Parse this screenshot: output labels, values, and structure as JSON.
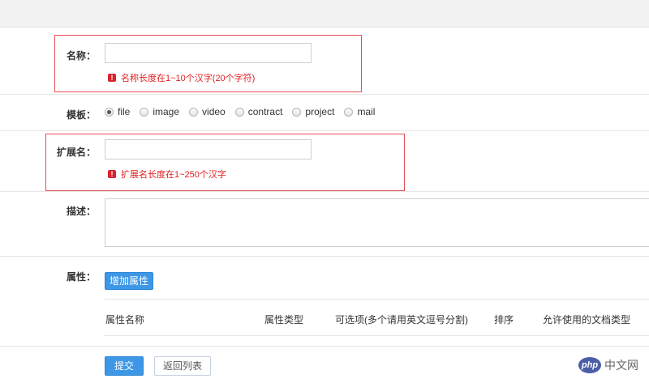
{
  "form": {
    "name": {
      "label": "名称：",
      "value": "",
      "error": "名称长度在1~10个汉字(20个字符)"
    },
    "template": {
      "label": "模板：",
      "selected": "file",
      "options": [
        {
          "label": "file",
          "checked": true
        },
        {
          "label": "image",
          "checked": false
        },
        {
          "label": "video",
          "checked": false
        },
        {
          "label": "contract",
          "checked": false
        },
        {
          "label": "project",
          "checked": false
        },
        {
          "label": "mail",
          "checked": false
        }
      ]
    },
    "extension": {
      "label": "扩展名：",
      "value": "",
      "error": "扩展名长度在1~250个汉字"
    },
    "description": {
      "label": "描述：",
      "value": ""
    },
    "attributes": {
      "label": "属性：",
      "add_button": "增加属性",
      "columns": [
        "属性名称",
        "属性类型",
        "可选项(多个请用英文逗号分割)",
        "排序",
        "允许使用的文档类型"
      ]
    },
    "actions": {
      "submit": "提交",
      "back": "返回列表"
    }
  },
  "watermark": {
    "logo": "php",
    "text": "中文网"
  },
  "colors": {
    "error": "#e02020",
    "error_border": "#e64c55",
    "primary": "#3d97e6"
  }
}
